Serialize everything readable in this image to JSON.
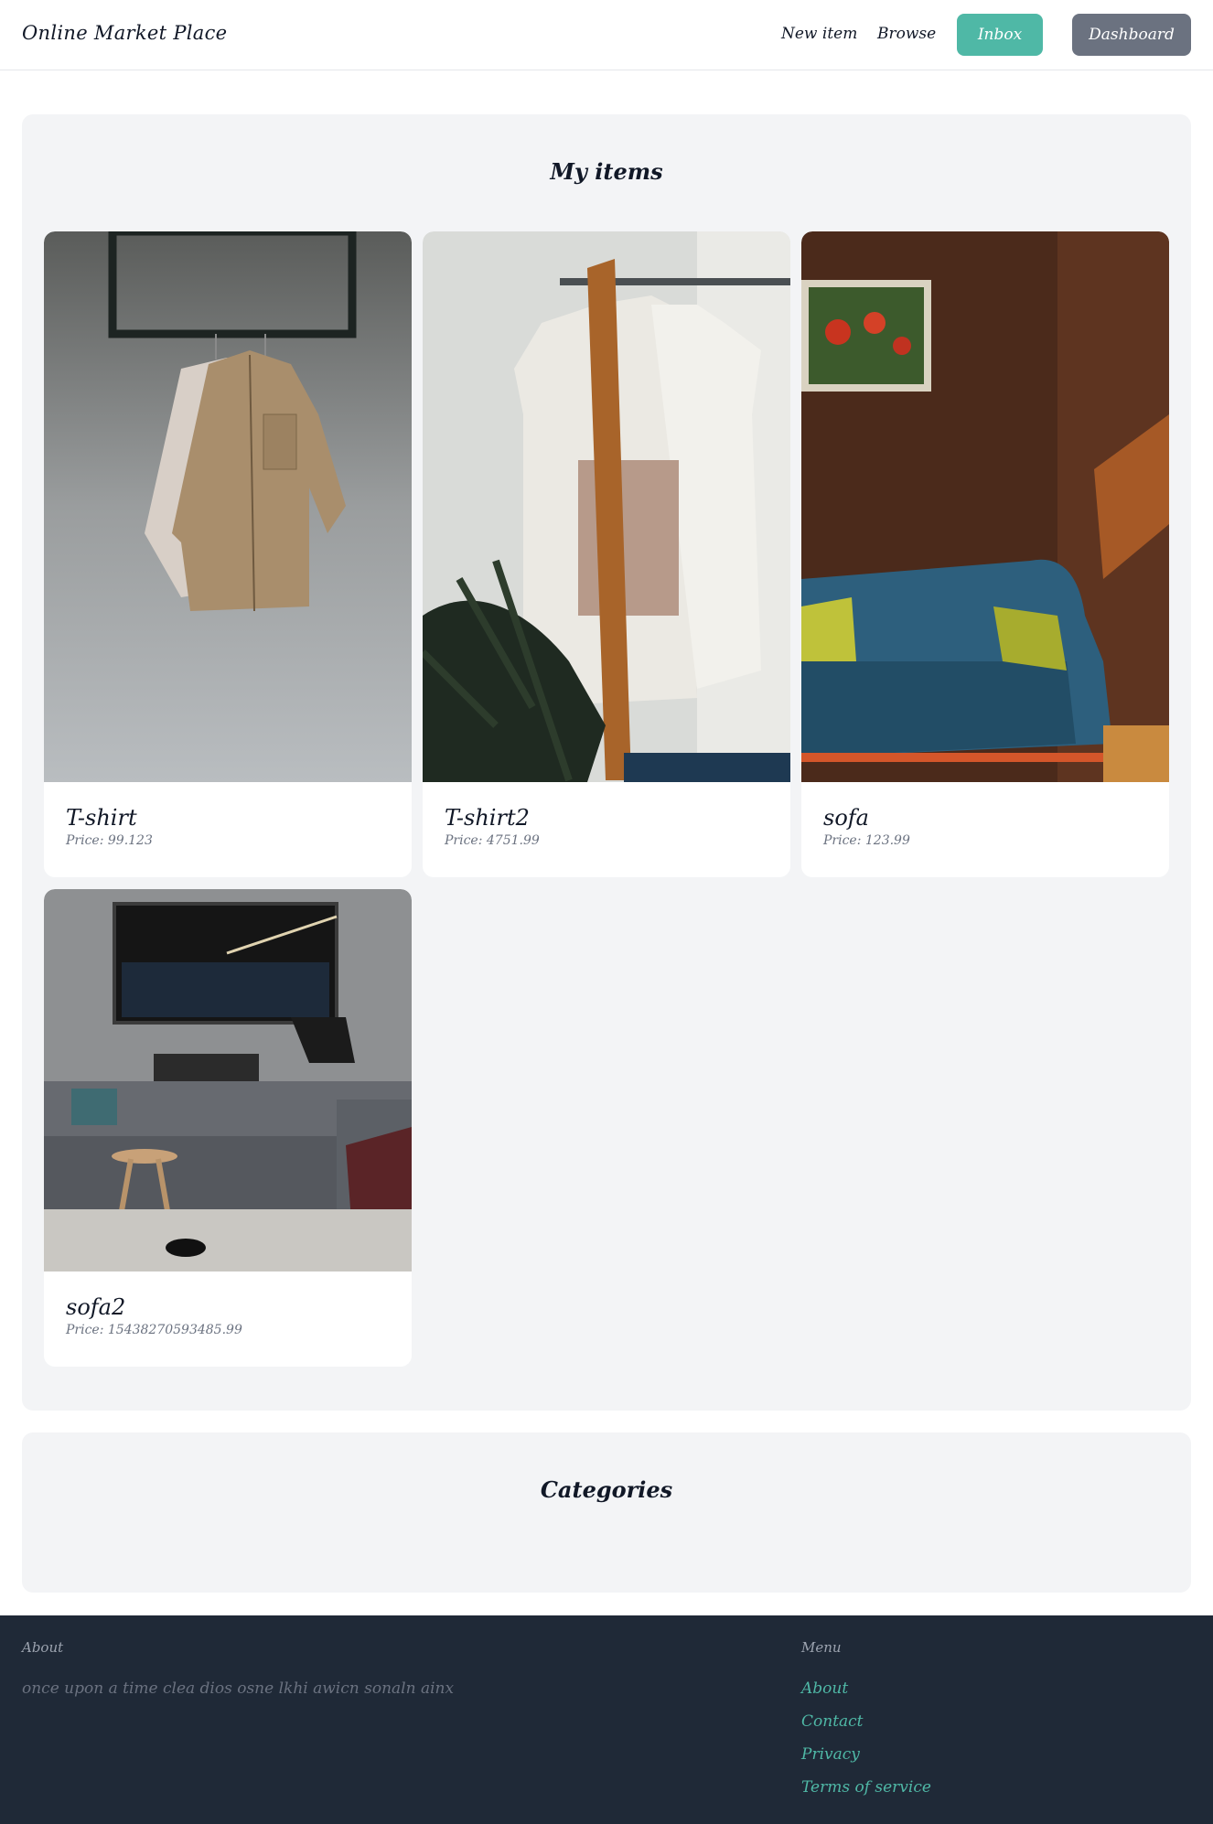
{
  "navbar": {
    "brand": "Online Market Place",
    "links": {
      "new_item": "New item",
      "browse": "Browse"
    },
    "buttons": {
      "inbox": "Inbox",
      "dashboard": "Dashboard"
    }
  },
  "my_items": {
    "title": "My items",
    "items": [
      {
        "name": "T-shirt",
        "price": "Price: 99.123",
        "image": "shirts-on-hanger-photo"
      },
      {
        "name": "T-shirt2",
        "price": "Price: 4751.99",
        "image": "tshirts-on-rack-photo"
      },
      {
        "name": "sofa",
        "price": "Price: 123.99",
        "image": "blue-sofa-photo"
      },
      {
        "name": "sofa2",
        "price": "Price: 15438270593485.99",
        "image": "living-room-sofa-photo"
      }
    ]
  },
  "categories": {
    "title": "Categories"
  },
  "footer": {
    "about": {
      "heading": "About",
      "text": "once upon a time clea dios osne lkhi awicn sonaln ainx"
    },
    "menu": {
      "heading": "Menu",
      "links": [
        "About",
        "Contact",
        "Privacy",
        "Terms of service"
      ]
    }
  },
  "colors": {
    "accent": "#4fb8a6",
    "dashboard_button": "#6b7280",
    "panel_bg": "#f3f4f6",
    "footer_bg": "#1f2937"
  }
}
